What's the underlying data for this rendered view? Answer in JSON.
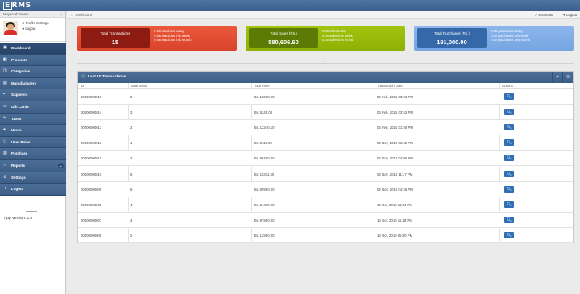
{
  "app": {
    "logo": "ERMS"
  },
  "user": {
    "name": "Muyaned Venam",
    "profile_settings": "Profile Settings",
    "logout": "Logout"
  },
  "sidebar": {
    "items": [
      {
        "label": "Dashboard",
        "icon": "dashboard-icon",
        "active": true
      },
      {
        "label": "Products",
        "icon": "box-icon"
      },
      {
        "label": "Categories",
        "icon": "tags-icon"
      },
      {
        "label": "Manufacturers",
        "icon": "factory-icon"
      },
      {
        "label": "Suppliers",
        "icon": "truck-icon"
      },
      {
        "label": "Gift Cards",
        "icon": "gift-card-icon"
      },
      {
        "label": "Taxes",
        "icon": "tax-icon"
      },
      {
        "label": "Users",
        "icon": "user-icon"
      },
      {
        "label": "User Roles",
        "icon": "user-roles-icon"
      },
      {
        "label": "Purchase",
        "icon": "purchase-icon"
      },
      {
        "label": "Reports",
        "icon": "chart-icon",
        "expandable": true
      },
      {
        "label": "Settings",
        "icon": "gear-icon"
      },
      {
        "label": "Logout",
        "icon": "logout-icon"
      }
    ],
    "version": "App Version: 1.0"
  },
  "breadcrumb": {
    "current": "Dashboard"
  },
  "topbar": {
    "shortcuts": "Shortcuts",
    "logout": "Logout"
  },
  "stats": {
    "transactions": {
      "label": "Total Transactions",
      "value": "15",
      "lines": [
        "0 transactions today",
        "0 transactions this week",
        "0 transactions this month"
      ]
    },
    "sales": {
      "label": "Total Sales (Rs.)",
      "value": "580,606.60",
      "lines": [
        "0.00 sales today",
        "0.00 sales this week",
        "0.00 sales this month"
      ]
    },
    "purchases": {
      "label": "Total Purchases (Rs.)",
      "value": "191,000.00",
      "lines": [
        "0.00 purchases today",
        "0.00 purchases this week",
        "0.00 purchases this month"
      ]
    }
  },
  "panel": {
    "title": "Last 10 Transactions",
    "columns": [
      "ID",
      "Total Items",
      "Total Price",
      "Transaction Date",
      "Actions"
    ],
    "rows": [
      {
        "id": "00000000015",
        "items": "2",
        "price": "Rs. 12990.00",
        "date": "06 Feb, 2021 03:53 PM"
      },
      {
        "id": "00000000014",
        "items": "3",
        "price": "Rs. 5245.00",
        "date": "06 Feb, 2021 03:52 PM"
      },
      {
        "id": "00000000013",
        "items": "2",
        "price": "Rs. 12340.10",
        "date": "06 Feb, 2021 01:50 PM"
      },
      {
        "id": "00000000012",
        "items": "1",
        "price": "Rs. 2115.00",
        "date": "06 Nov, 2019 06:42 PM"
      },
      {
        "id": "00000000011",
        "items": "3",
        "price": "Rs. 86400.00",
        "date": "04 Nov, 2019 04:00 PM"
      },
      {
        "id": "00000000010",
        "items": "6",
        "price": "Rs. 15311.50",
        "date": "03 Nov, 2019 11:47 PM"
      },
      {
        "id": "00000000009",
        "items": "5",
        "price": "Rs. 05990.00",
        "date": "02 Nov, 2019 04:26 PM"
      },
      {
        "id": "00000000008",
        "items": "4",
        "price": "Rs. 21499.00",
        "date": "14 Oct, 2019 11:54 PM"
      },
      {
        "id": "00000000007",
        "items": "4",
        "price": "Rs. 97990.00",
        "date": "14 Oct, 2019 11:29 PM"
      },
      {
        "id": "00000000006",
        "items": "2",
        "price": "Rs. 12990.00",
        "date": "14 Oct, 2019 05:50 PM"
      }
    ]
  },
  "colors": {
    "header_blue": "#3b5f8d",
    "red": "#d9432a",
    "green": "#8fb004",
    "blue": "#76a5e0",
    "action_blue": "#2f6fb7"
  }
}
